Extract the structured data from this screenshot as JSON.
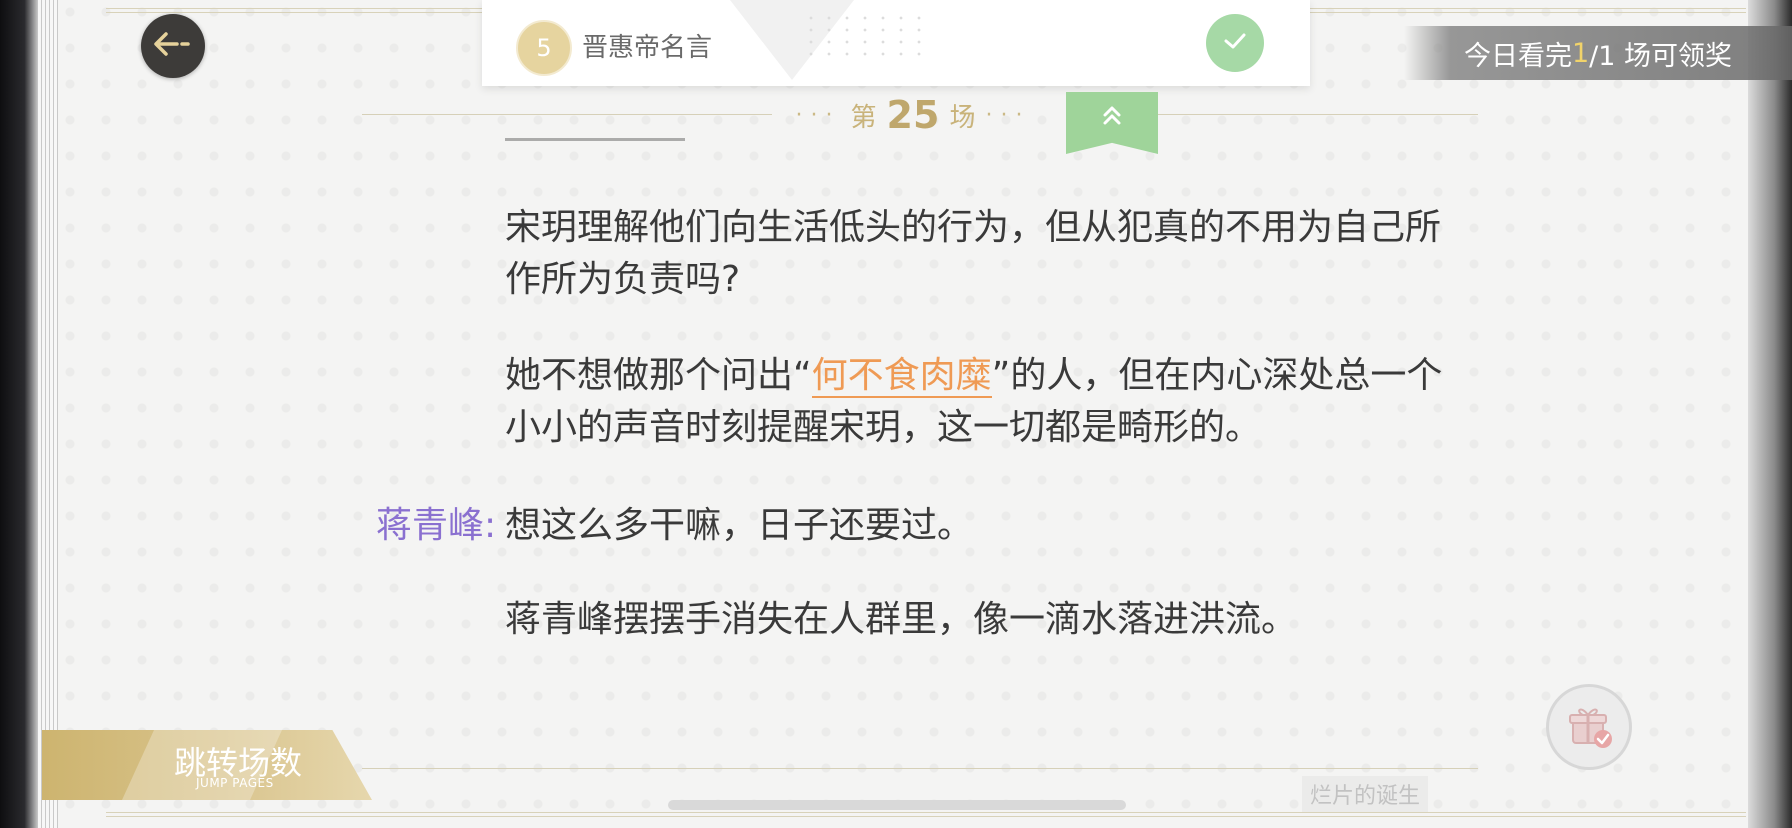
{
  "header": {
    "quote_number": "5",
    "quote_title": "晋惠帝名言",
    "reward_prefix": "今日看完",
    "reward_count": "1",
    "reward_suffix": "/1 场可领奖"
  },
  "scene": {
    "prefix": "第",
    "number": "25",
    "suffix": "场"
  },
  "content": {
    "para1": "宋玥理解他们向生活低头的行为，但从犯真的不用为自己所作所为负责吗?",
    "para2_before": "她不想做那个问出“",
    "para2_highlight": "何不食肉糜",
    "para2_after": "”的人，但在内心深处总一个小小的声音时刻提醒宋玥，这一切都是畸形的。",
    "speaker": "蒋青峰:",
    "dialogue": "想这么多干嘛，日子还要过。",
    "para4": "蒋青峰摆摆手消失在人群里，像一滴水落进洪流。"
  },
  "footer": {
    "jump_title": "跳转场数",
    "jump_sub": "JUMP PAGES",
    "chapter_title": "烂片的诞生"
  },
  "colors": {
    "accent_gold": "#c9b37a",
    "speaker_purple": "#8a70d0",
    "highlight_orange": "#ef9a54",
    "green": "#9fd49a"
  }
}
